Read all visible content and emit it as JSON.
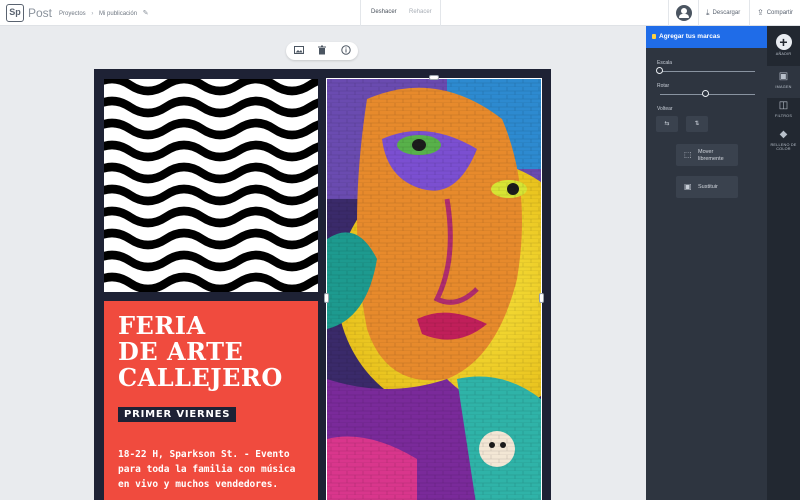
{
  "app": {
    "logo_abbr": "Sp",
    "logo_name": "Post"
  },
  "breadcrumb": {
    "projects": "Proyectos",
    "current": "Mi publicación"
  },
  "toolbar": {
    "undo": "Deshacer",
    "redo": "Rehacer",
    "download": "Descargar",
    "share": "Compartir"
  },
  "poster": {
    "headline_1": "FERIA",
    "headline_2": "DE ARTE",
    "headline_3": "CALLEJERO",
    "tag": "PRIMER VIERNES",
    "desc_1": "18-22 H, Sparkson St. - Evento",
    "desc_2": "para toda la familia con música",
    "desc_3": "en vivo y muchos vendedores.",
    "colors": {
      "navy": "#1e2235",
      "red": "#f04b3e"
    }
  },
  "panel": {
    "title": "Agregar tus marcas",
    "scale_label": "Escala",
    "rotate_label": "Rotar",
    "scale_value": 0,
    "rotate_value": 0.5,
    "flip_label": "Voltear",
    "move_freely_1": "Mover",
    "move_freely_2": "libremente",
    "replace": "Sustituir",
    "accent_color": "#1f6ce8"
  },
  "rail": {
    "add": "AÑADIR",
    "images": "IMAGEN",
    "filters": "FILTROS",
    "fill": "RELLENO DE COLOR"
  }
}
